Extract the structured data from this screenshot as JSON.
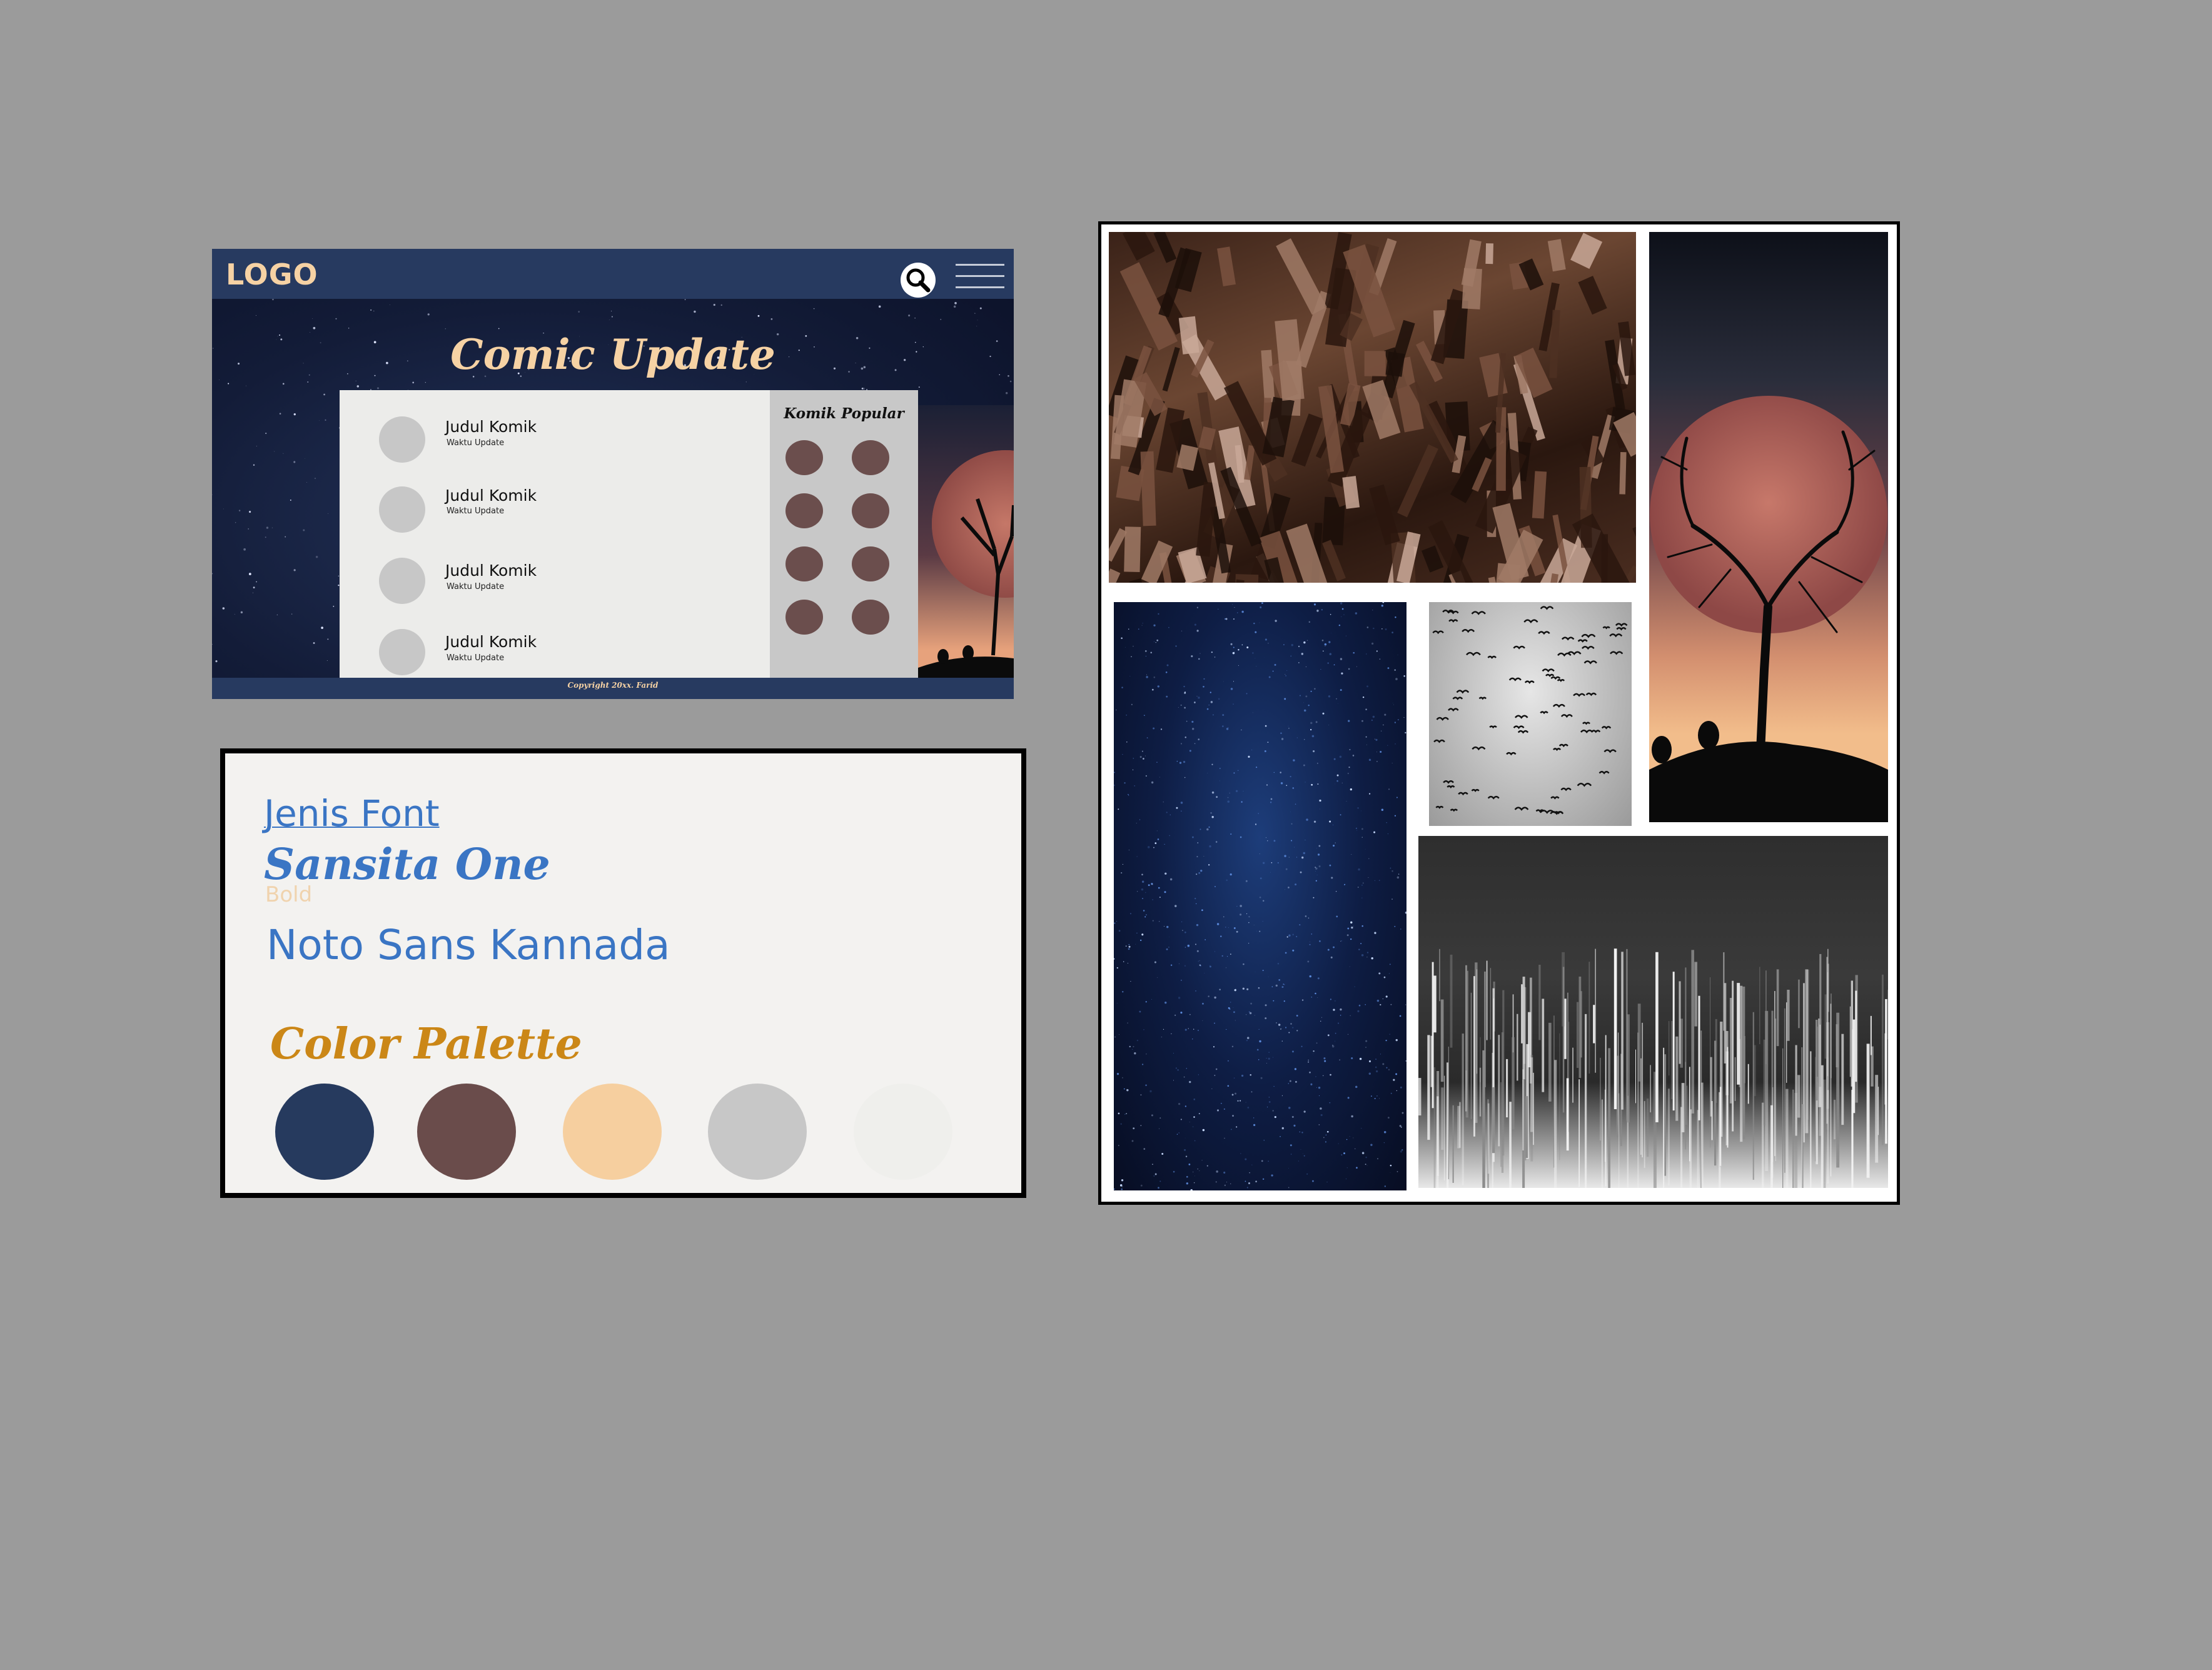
{
  "site": {
    "logo": "LOGO",
    "headline": "Comic Update",
    "popular_title": "Komik Popular",
    "items": [
      {
        "title": "Judul Komik",
        "time": "Waktu Update"
      },
      {
        "title": "Judul Komik",
        "time": "Waktu Update"
      },
      {
        "title": "Judul Komik",
        "time": "Waktu Update"
      },
      {
        "title": "Judul Komik",
        "time": "Waktu Update"
      }
    ],
    "copyright": "Copyright 20xx. Farid",
    "icons": [
      "search-icon",
      "hamburger-menu-icon"
    ]
  },
  "fonts": {
    "heading": "Jenis Font",
    "font1": "Sansita One",
    "font1_weight": "Bold",
    "font2": "Noto Sans Kannada"
  },
  "palette": {
    "title": "Color Palette",
    "colors": [
      "#263a5e",
      "#6a4c4b",
      "#f6cf9f",
      "#c7c7c7",
      "#efefec"
    ]
  }
}
